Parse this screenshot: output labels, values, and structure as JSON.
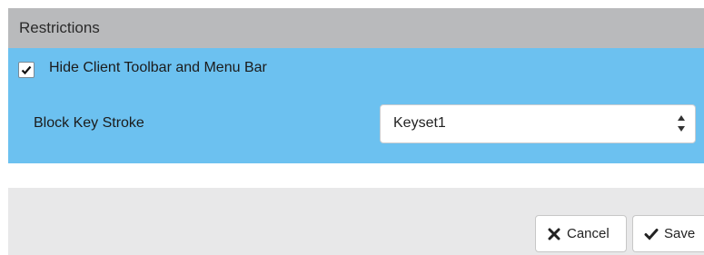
{
  "panel": {
    "title": "Restrictions"
  },
  "restrictions": {
    "hide_toolbar": {
      "label": "Hide Client Toolbar and Menu Bar",
      "checked": true
    },
    "block_key_stroke": {
      "label": "Block Key Stroke",
      "selected": "Keyset1"
    }
  },
  "actions": {
    "cancel_label": "Cancel",
    "save_label": "Save"
  },
  "colors": {
    "header_bg": "#b9babc",
    "active_bg": "#6cc1f0",
    "panel_bg": "#e8e8e9"
  },
  "icons": {
    "checkbox": "check-icon",
    "select": "sort-arrows-icon",
    "cancel": "x-icon",
    "save": "check-icon"
  }
}
